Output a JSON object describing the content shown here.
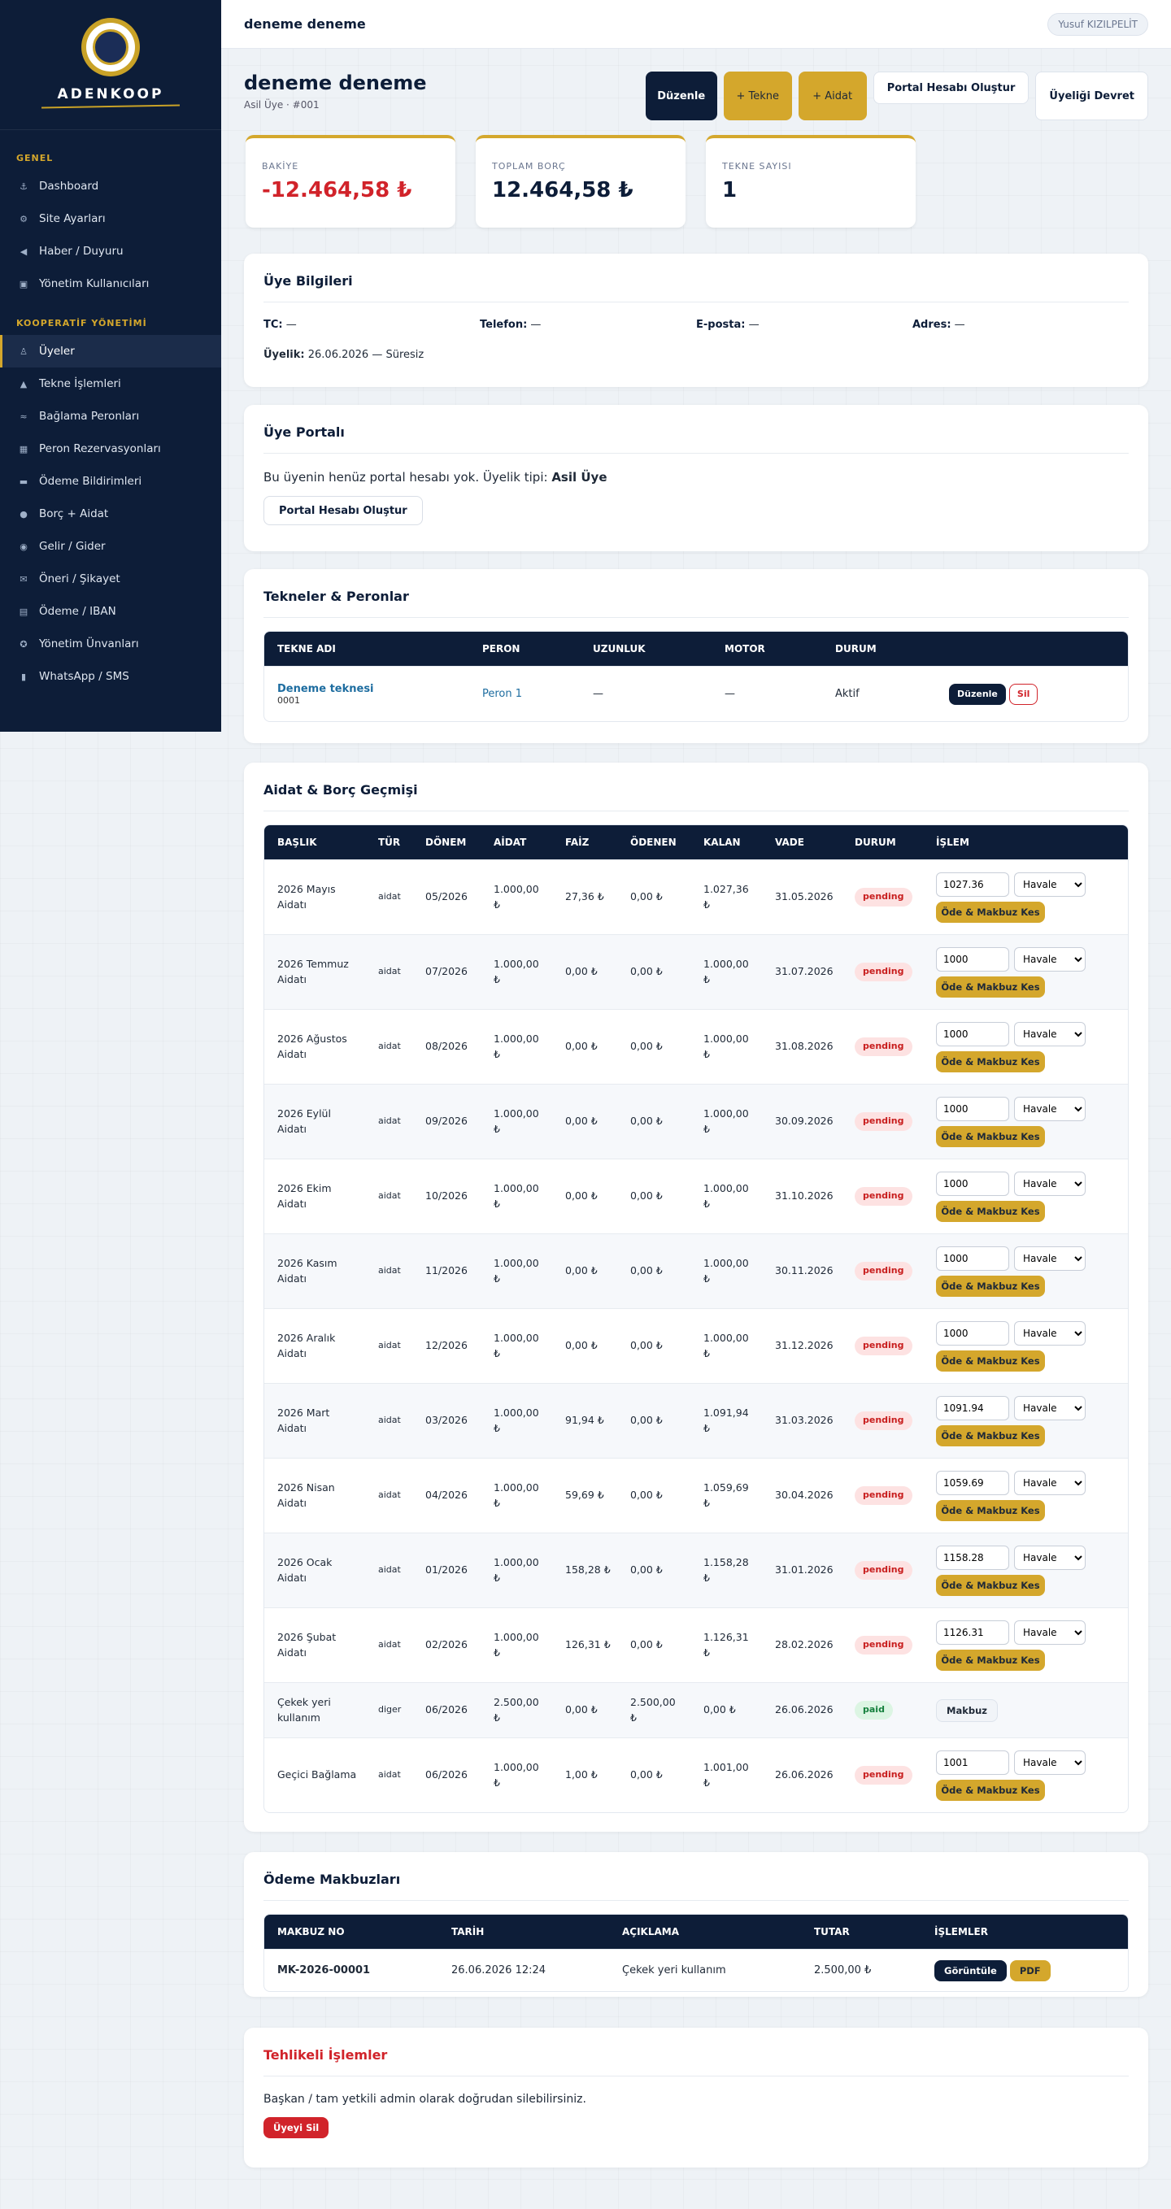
{
  "brand": {
    "name": "ADENKOOP"
  },
  "sidebar": {
    "section1": "GENEL",
    "section2": "KOOPERATİF YÖNETİMİ",
    "general": [
      {
        "label": "Dashboard",
        "icon": "anchor-icon"
      },
      {
        "label": "Site Ayarları",
        "icon": "gear-icon"
      },
      {
        "label": "Haber / Duyuru",
        "icon": "megaphone-icon"
      },
      {
        "label": "Yönetim Kullanıcıları",
        "icon": "user-admin-icon"
      }
    ],
    "coop": [
      {
        "label": "Üyeler",
        "icon": "members-icon"
      },
      {
        "label": "Tekne İşlemleri",
        "icon": "sailboat-icon"
      },
      {
        "label": "Bağlama Peronları",
        "icon": "dock-icon"
      },
      {
        "label": "Peron Rezervasyonları",
        "icon": "calendar-icon"
      },
      {
        "label": "Ödeme Bildirimleri",
        "icon": "card-icon"
      },
      {
        "label": "Borç + Aidat",
        "icon": "coins-icon"
      },
      {
        "label": "Gelir / Gider",
        "icon": "money-bag-icon"
      },
      {
        "label": "Öneri / Şikayet",
        "icon": "mail-icon"
      },
      {
        "label": "Ödeme / IBAN",
        "icon": "bank-icon"
      },
      {
        "label": "Yönetim Ünvanları",
        "icon": "medal-icon"
      },
      {
        "label": "WhatsApp / SMS",
        "icon": "phone-icon"
      }
    ]
  },
  "topbar": {
    "title": "deneme deneme",
    "user": "Yusuf KIZILPELİT"
  },
  "header": {
    "title": "deneme deneme",
    "subtitle": "Asil Üye · #001",
    "edit": "Düzenle",
    "add_boat": "+ Tekne",
    "add_fee": "+ Aidat",
    "create_portal": "Portal Hesabı Oluştur",
    "transfer": "Üyeliği Devret"
  },
  "stats": [
    {
      "label": "BAKİYE",
      "value": "-12.464,58 ₺"
    },
    {
      "label": "TOPLAM BORÇ",
      "value": "12.464,58 ₺"
    },
    {
      "label": "TEKNE SAYISI",
      "value": "1"
    }
  ],
  "member_info": {
    "title": "Üye Bilgileri",
    "tc_label": "TC:",
    "tc": "—",
    "phone_label": "Telefon:",
    "phone": "—",
    "email_label": "E-posta:",
    "email": "—",
    "address_label": "Adres:",
    "address": "—",
    "membership_label": "Üyelik:",
    "membership": "26.06.2026 — Süresiz"
  },
  "portal": {
    "title": "Üye Portalı",
    "text": "Bu üyenin henüz portal hesabı yok. Üyelik tipi:",
    "type": "Asil Üye",
    "button": "Portal Hesabı Oluştur"
  },
  "boats": {
    "title": "Tekneler & Peronlar",
    "columns": [
      "TEKNE ADI",
      "PERON",
      "UZUNLUK",
      "MOTOR",
      "DURUM"
    ],
    "rows": [
      {
        "name": "Deneme teknesi",
        "code": "0001",
        "peron": "Peron 1",
        "length": "—",
        "motor": "—",
        "status": "Aktif",
        "edit": "Düzenle",
        "delete": "Sil"
      }
    ]
  },
  "debts": {
    "title": "Aidat & Borç Geçmişi",
    "columns": [
      "BAŞLIK",
      "TÜR",
      "DÖNEM",
      "AİDAT",
      "FAİZ",
      "ÖDENEN",
      "KALAN",
      "VADE",
      "DURUM",
      "İŞLEM"
    ],
    "pay_button": "Öde & Makbuz Kes",
    "receipt_button": "Makbuz",
    "method_options": [
      "Havale"
    ],
    "rows": [
      {
        "title": "2026 Mayıs Aidatı",
        "type": "aidat",
        "period": "05/2026",
        "fee": "1.000,00 ₺",
        "interest": "27,36 ₺",
        "paid": "0,00 ₺",
        "remaining": "1.027,36 ₺",
        "due": "31.05.2026",
        "status": "pending",
        "amount": "1027.36",
        "method": "Havale"
      },
      {
        "title": "2026 Temmuz Aidatı",
        "type": "aidat",
        "period": "07/2026",
        "fee": "1.000,00 ₺",
        "interest": "0,00 ₺",
        "paid": "0,00 ₺",
        "remaining": "1.000,00 ₺",
        "due": "31.07.2026",
        "status": "pending",
        "amount": "1000",
        "method": "Havale"
      },
      {
        "title": "2026 Ağustos Aidatı",
        "type": "aidat",
        "period": "08/2026",
        "fee": "1.000,00 ₺",
        "interest": "0,00 ₺",
        "paid": "0,00 ₺",
        "remaining": "1.000,00 ₺",
        "due": "31.08.2026",
        "status": "pending",
        "amount": "1000",
        "method": "Havale"
      },
      {
        "title": "2026 Eylül Aidatı",
        "type": "aidat",
        "period": "09/2026",
        "fee": "1.000,00 ₺",
        "interest": "0,00 ₺",
        "paid": "0,00 ₺",
        "remaining": "1.000,00 ₺",
        "due": "30.09.2026",
        "status": "pending",
        "amount": "1000",
        "method": "Havale"
      },
      {
        "title": "2026 Ekim Aidatı",
        "type": "aidat",
        "period": "10/2026",
        "fee": "1.000,00 ₺",
        "interest": "0,00 ₺",
        "paid": "0,00 ₺",
        "remaining": "1.000,00 ₺",
        "due": "31.10.2026",
        "status": "pending",
        "amount": "1000",
        "method": "Havale"
      },
      {
        "title": "2026 Kasım Aidatı",
        "type": "aidat",
        "period": "11/2026",
        "fee": "1.000,00 ₺",
        "interest": "0,00 ₺",
        "paid": "0,00 ₺",
        "remaining": "1.000,00 ₺",
        "due": "30.11.2026",
        "status": "pending",
        "amount": "1000",
        "method": "Havale"
      },
      {
        "title": "2026 Aralık Aidatı",
        "type": "aidat",
        "period": "12/2026",
        "fee": "1.000,00 ₺",
        "interest": "0,00 ₺",
        "paid": "0,00 ₺",
        "remaining": "1.000,00 ₺",
        "due": "31.12.2026",
        "status": "pending",
        "amount": "1000",
        "method": "Havale"
      },
      {
        "title": "2026 Mart Aidatı",
        "type": "aidat",
        "period": "03/2026",
        "fee": "1.000,00 ₺",
        "interest": "91,94 ₺",
        "paid": "0,00 ₺",
        "remaining": "1.091,94 ₺",
        "due": "31.03.2026",
        "status": "pending",
        "amount": "1091.94",
        "method": "Havale"
      },
      {
        "title": "2026 Nisan Aidatı",
        "type": "aidat",
        "period": "04/2026",
        "fee": "1.000,00 ₺",
        "interest": "59,69 ₺",
        "paid": "0,00 ₺",
        "remaining": "1.059,69 ₺",
        "due": "30.04.2026",
        "status": "pending",
        "amount": "1059.69",
        "method": "Havale"
      },
      {
        "title": "2026 Ocak Aidatı",
        "type": "aidat",
        "period": "01/2026",
        "fee": "1.000,00 ₺",
        "interest": "158,28 ₺",
        "paid": "0,00 ₺",
        "remaining": "1.158,28 ₺",
        "due": "31.01.2026",
        "status": "pending",
        "amount": "1158.28",
        "method": "Havale"
      },
      {
        "title": "2026 Şubat Aidatı",
        "type": "aidat",
        "period": "02/2026",
        "fee": "1.000,00 ₺",
        "interest": "126,31 ₺",
        "paid": "0,00 ₺",
        "remaining": "1.126,31 ₺",
        "due": "28.02.2026",
        "status": "pending",
        "amount": "1126.31",
        "method": "Havale"
      },
      {
        "title": "Çekek yeri kullanım",
        "type": "diger",
        "period": "06/2026",
        "fee": "2.500,00 ₺",
        "interest": "0,00 ₺",
        "paid": "2.500,00 ₺",
        "remaining": "0,00 ₺",
        "due": "26.06.2026",
        "status": "paid"
      },
      {
        "title": "Geçici Bağlama",
        "type": "aidat",
        "period": "06/2026",
        "fee": "1.000,00 ₺",
        "interest": "1,00 ₺",
        "paid": "0,00 ₺",
        "remaining": "1.001,00 ₺",
        "due": "26.06.2026",
        "status": "pending",
        "amount": "1001",
        "method": "Havale"
      }
    ]
  },
  "receipts": {
    "title": "Ödeme Makbuzları",
    "columns": [
      "MAKBUZ NO",
      "TARİH",
      "AÇIKLAMA",
      "TUTAR",
      "İŞLEMLER"
    ],
    "rows": [
      {
        "no": "MK-2026-00001",
        "date": "26.06.2026 12:24",
        "desc": "Çekek yeri kullanım",
        "amount": "2.500,00 ₺",
        "view": "Görüntüle",
        "pdf": "PDF"
      }
    ]
  },
  "danger": {
    "title": "Tehlikeli İşlemler",
    "text": "Başkan / tam yetkili admin olarak doğrudan silebilirsiniz.",
    "button": "Üyeyi Sil"
  }
}
